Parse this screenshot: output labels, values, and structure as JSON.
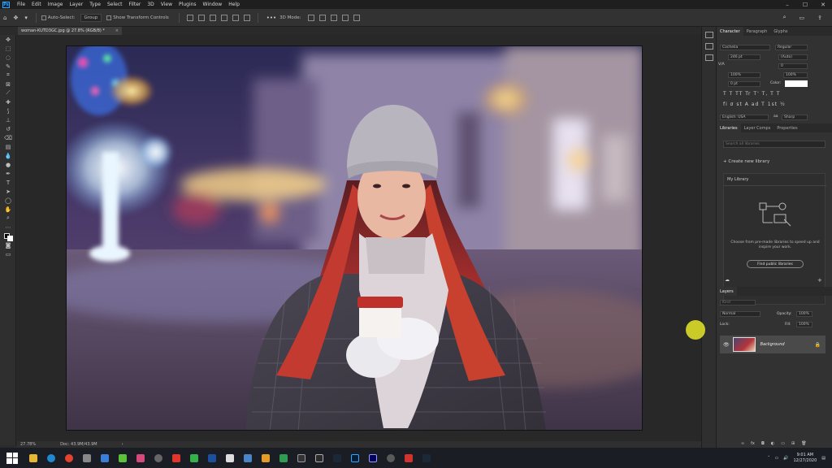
{
  "menubar": {
    "logo": "Ps",
    "items": [
      "File",
      "Edit",
      "Image",
      "Layer",
      "Type",
      "Select",
      "Filter",
      "3D",
      "View",
      "Plugins",
      "Window",
      "Help"
    ],
    "controls": [
      "–",
      "☐",
      "✕"
    ]
  },
  "options": {
    "auto_select_label": "Auto-Select:",
    "auto_select_value": "Group",
    "transform_label": "Show Transform Controls",
    "mode_label": "3D Mode:",
    "more": "•••"
  },
  "document": {
    "tab_title": "woman-KUTD3GC.jpg @ 27.8% (RGB/8) *",
    "close": "×"
  },
  "status": {
    "zoom": "27.78%",
    "doc": "Doc: 43.9M/43.9M",
    "arrow": "›"
  },
  "character": {
    "tabs": [
      "Character",
      "Paragraph",
      "Glyphs"
    ],
    "font_family": "Cochelia",
    "font_style": "Regular",
    "font_size": "246 pt",
    "leading": "(Auto)",
    "tracking": "0",
    "vertical_scale": "100%",
    "horizontal_scale": "100%",
    "baseline": "0 pt",
    "color_label": "Color:",
    "type_buttons": "T  T  TT  Tr  T'  T,  T  T",
    "opentype_buttons": "fi  σ  st  A  ad  T  1st  ½",
    "language": "English: USA",
    "antialias": "Sharp",
    "va_label": "V/A",
    "tt_label": "aa"
  },
  "libraries": {
    "tabs": [
      "Libraries",
      "Layer Comps",
      "Properties"
    ],
    "search_placeholder": "Search all libraries",
    "create_label": "Create new library",
    "library_name": "My Library",
    "description": "Choose from pre-made libraries to speed up and inspire your work.",
    "find_button": "Find public libraries",
    "cloud_icon": "cloud-icon",
    "add": "+"
  },
  "layers": {
    "tab": "Layers",
    "kind_placeholder": "Kind",
    "blend_mode": "Normal",
    "opacity_label": "Opacity:",
    "opacity_value": "100%",
    "lock_label": "Lock:",
    "fill_label": "Fill:",
    "fill_value": "100%",
    "layer_name": "Background"
  },
  "taskbar": {
    "time": "9:01 AM",
    "date": "12/27/2020"
  }
}
